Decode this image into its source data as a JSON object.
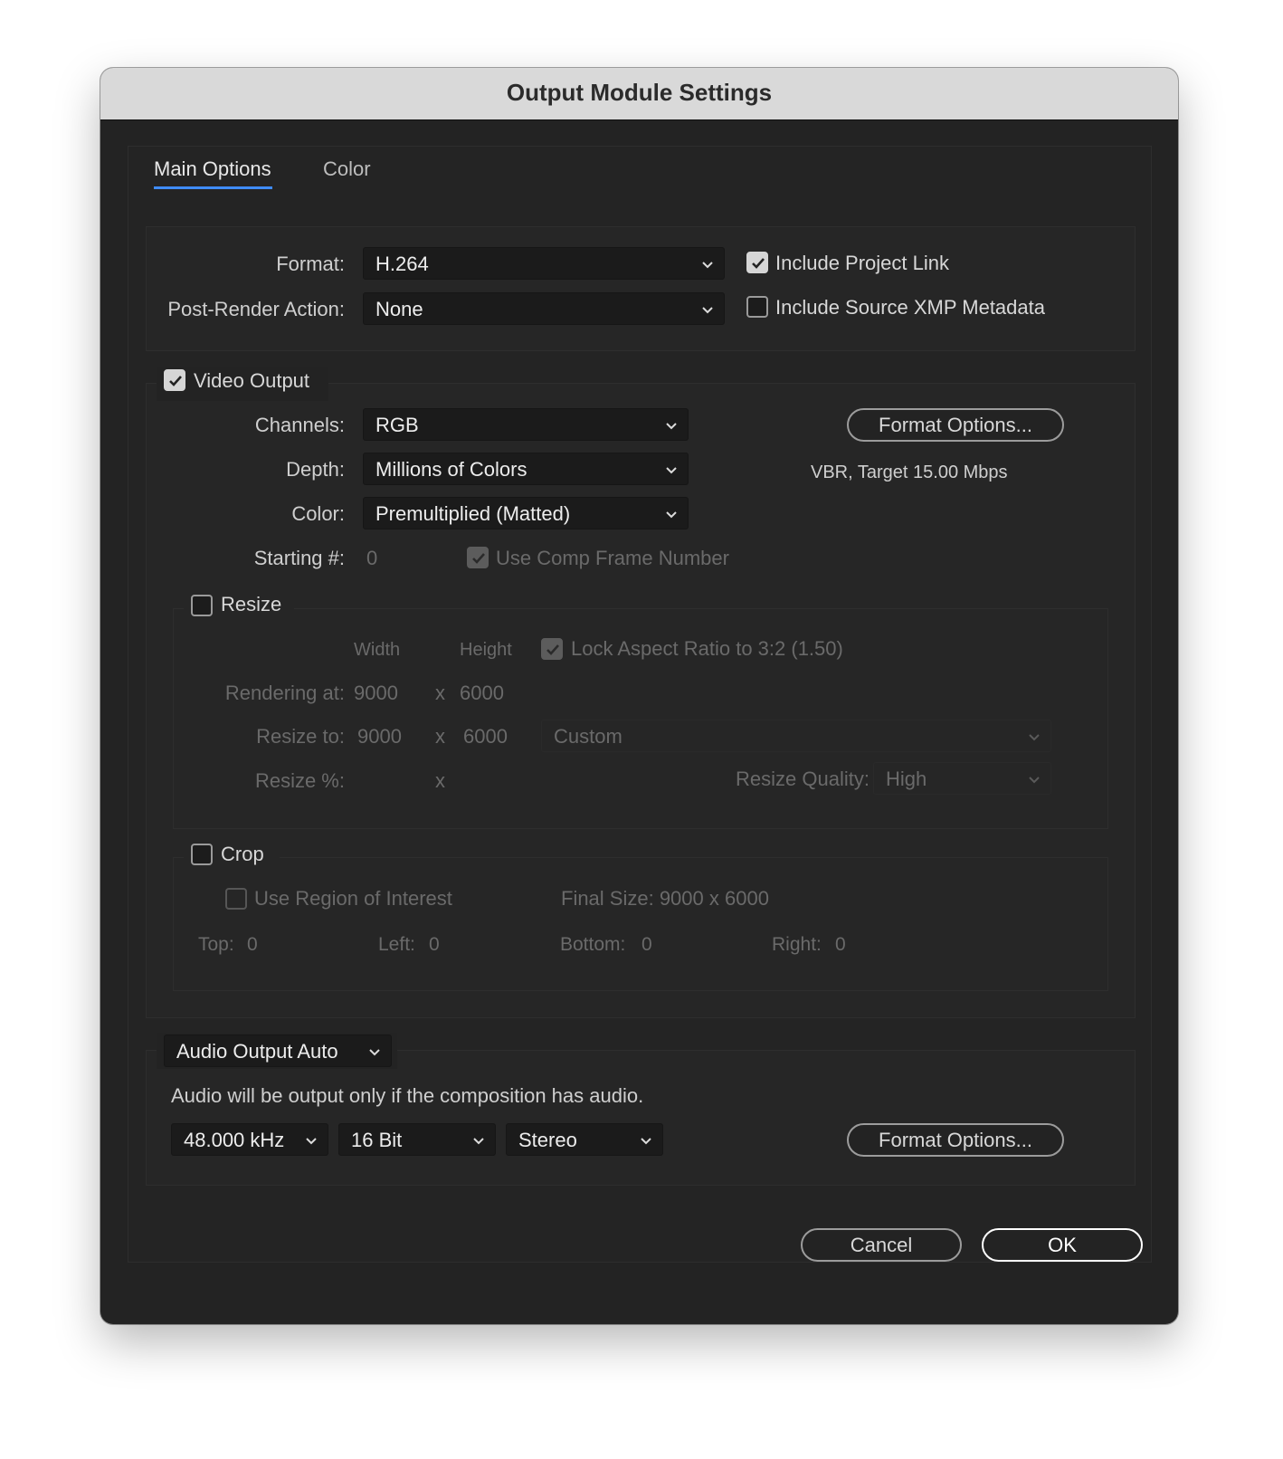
{
  "window": {
    "title": "Output Module Settings"
  },
  "tabs": [
    {
      "label": "Main Options",
      "active": true
    },
    {
      "label": "Color",
      "active": false
    }
  ],
  "top_section": {
    "format_label": "Format:",
    "format_value": "H.264",
    "post_render_label": "Post-Render Action:",
    "post_render_value": "None",
    "include_project_link": {
      "label": "Include Project Link",
      "checked": true
    },
    "include_xmp": {
      "label": "Include Source XMP Metadata",
      "checked": false
    }
  },
  "video_output": {
    "label": "Video Output",
    "checked": true,
    "channels_label": "Channels:",
    "channels_value": "RGB",
    "depth_label": "Depth:",
    "depth_value": "Millions of Colors",
    "color_label": "Color:",
    "color_value": "Premultiplied (Matted)",
    "starting_label": "Starting #:",
    "starting_value": "0",
    "use_comp_frame": {
      "label": "Use Comp Frame Number",
      "checked": true,
      "enabled": false
    },
    "format_options_label": "Format Options...",
    "format_summary": "VBR, Target 15.00 Mbps"
  },
  "resize": {
    "label": "Resize",
    "checked": false,
    "width_header": "Width",
    "height_header": "Height",
    "lock_aspect": {
      "label": "Lock Aspect Ratio to 3:2 (1.50)",
      "checked": true
    },
    "rendering_at_label": "Rendering at:",
    "rendering_w": "9000",
    "rendering_x": "x",
    "rendering_h": "6000",
    "resize_to_label": "Resize to:",
    "resize_w": "9000",
    "resize_x": "x",
    "resize_h": "6000",
    "preset_value": "Custom",
    "resize_pct_label": "Resize %:",
    "resize_pct_x": "x",
    "quality_label": "Resize Quality:",
    "quality_value": "High"
  },
  "crop": {
    "label": "Crop",
    "checked": false,
    "use_roi": {
      "label": "Use Region of Interest",
      "checked": false
    },
    "final_size": "Final Size: 9000 x 6000",
    "top_label": "Top:",
    "top_value": "0",
    "left_label": "Left:",
    "left_value": "0",
    "bottom_label": "Bottom:",
    "bottom_value": "0",
    "right_label": "Right:",
    "right_value": "0"
  },
  "audio": {
    "mode_value": "Audio Output Auto",
    "note": "Audio will be output only if the composition has audio.",
    "rate_value": "48.000 kHz",
    "bit_value": "16 Bit",
    "channels_value": "Stereo",
    "format_options_label": "Format Options..."
  },
  "footer": {
    "cancel_label": "Cancel",
    "ok_label": "OK"
  },
  "colors": {
    "accent": "#3f8cff",
    "window_bg": "#232323",
    "titlebar_bg": "#d9d9d9"
  },
  "icons": [
    "chevron-down-icon",
    "checkmark-icon"
  ]
}
